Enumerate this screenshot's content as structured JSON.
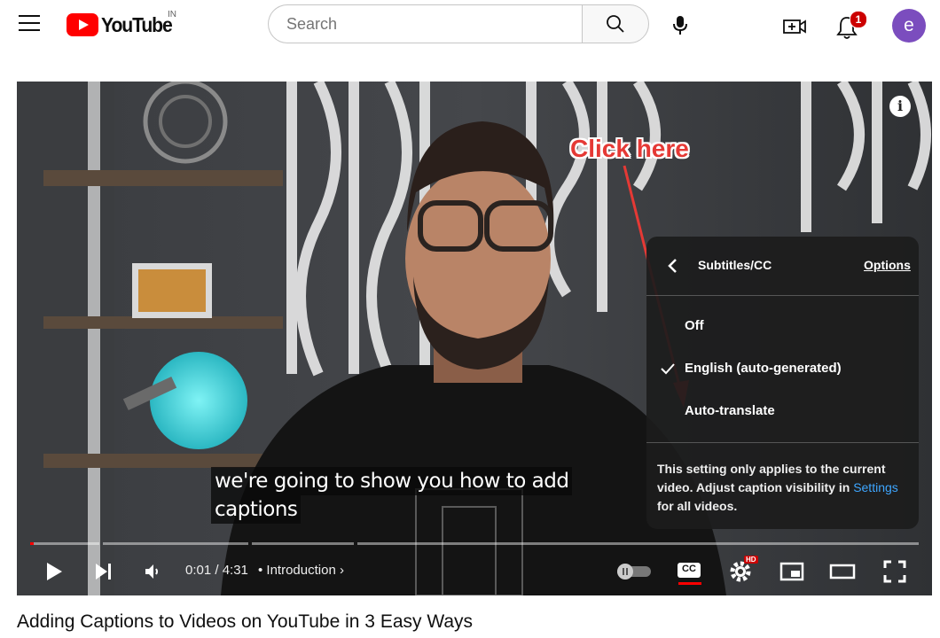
{
  "header": {
    "logo_text": "YouTube",
    "logo_country": "IN",
    "search_placeholder": "Search",
    "notifications_count": "1",
    "avatar_letter": "e",
    "icons": [
      "menu-icon",
      "youtube-logo",
      "search-icon",
      "mic-icon",
      "create-icon",
      "bell-icon"
    ]
  },
  "player": {
    "annotation": "Click here",
    "caption_line1": "we're going to show you how to add",
    "caption_line2": "captions",
    "menu": {
      "title": "Subtitles/CC",
      "options_label": "Options",
      "items": [
        {
          "label": "Off",
          "checked": false
        },
        {
          "label": "English (auto-generated)",
          "checked": true
        },
        {
          "label": "Auto-translate",
          "checked": false
        }
      ],
      "note_text": "This setting only applies to the current video. Adjust caption visibility in",
      "note_link": "Settings",
      "note_suffix": "for all videos."
    },
    "time_current": "0:01",
    "time_total": "4:31",
    "time_display": "0:01 / 4:31",
    "chapter": "Introduction",
    "progress": 0.004,
    "hd_badge": "HD",
    "cc_label": "CC"
  },
  "video_title": "Adding Captions to Videos on YouTube in 3 Easy Ways"
}
